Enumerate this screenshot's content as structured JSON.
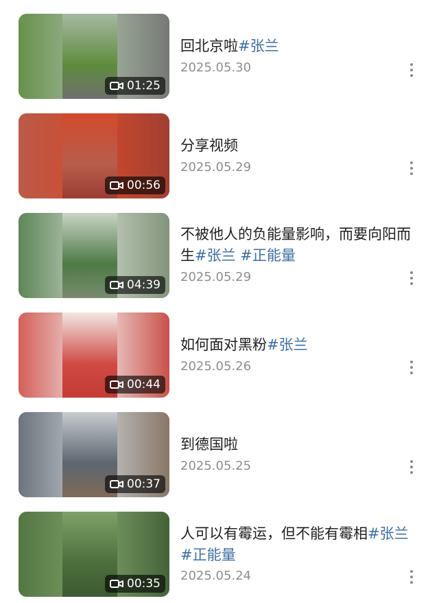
{
  "videos": [
    {
      "title_text": "回北京啦",
      "tags": "#张兰",
      "date": "2025.05.30",
      "duration": "01:25",
      "colors": [
        "#5e8c3c",
        "#a7b8a3",
        "#6f6f6f"
      ]
    },
    {
      "title_text": "分享视频",
      "tags": "",
      "date": "2025.05.29",
      "duration": "00:56",
      "colors": [
        "#b75d4c",
        "#d24a2b",
        "#9a3d33"
      ]
    },
    {
      "title_text": "不被他人的负能量影响，而要向阳而生",
      "tags": "#张兰 #正能量",
      "date": "2025.05.29",
      "duration": "04:39",
      "colors": [
        "#4e7a46",
        "#c9d3c6",
        "#788b70"
      ]
    },
    {
      "title_text": "如何面对黑粉",
      "tags": "#张兰",
      "date": "2025.05.26",
      "duration": "00:44",
      "colors": [
        "#d04a45",
        "#f1e7e4",
        "#c53a33"
      ]
    },
    {
      "title_text": "到德国啦",
      "tags": "",
      "date": "2025.05.25",
      "duration": "00:37",
      "colors": [
        "#5d6670",
        "#c8ccd0",
        "#7f6a57"
      ]
    },
    {
      "title_text": "人可以有霉运，但不能有霉相",
      "tags": "#张兰 #正能量",
      "date": "2025.05.24",
      "duration": "00:35",
      "colors": [
        "#4d6f3c",
        "#7ea069",
        "#3c5a33"
      ]
    }
  ],
  "icons": {
    "duration": "video-camera-icon",
    "menu": "more-vertical-icon"
  }
}
